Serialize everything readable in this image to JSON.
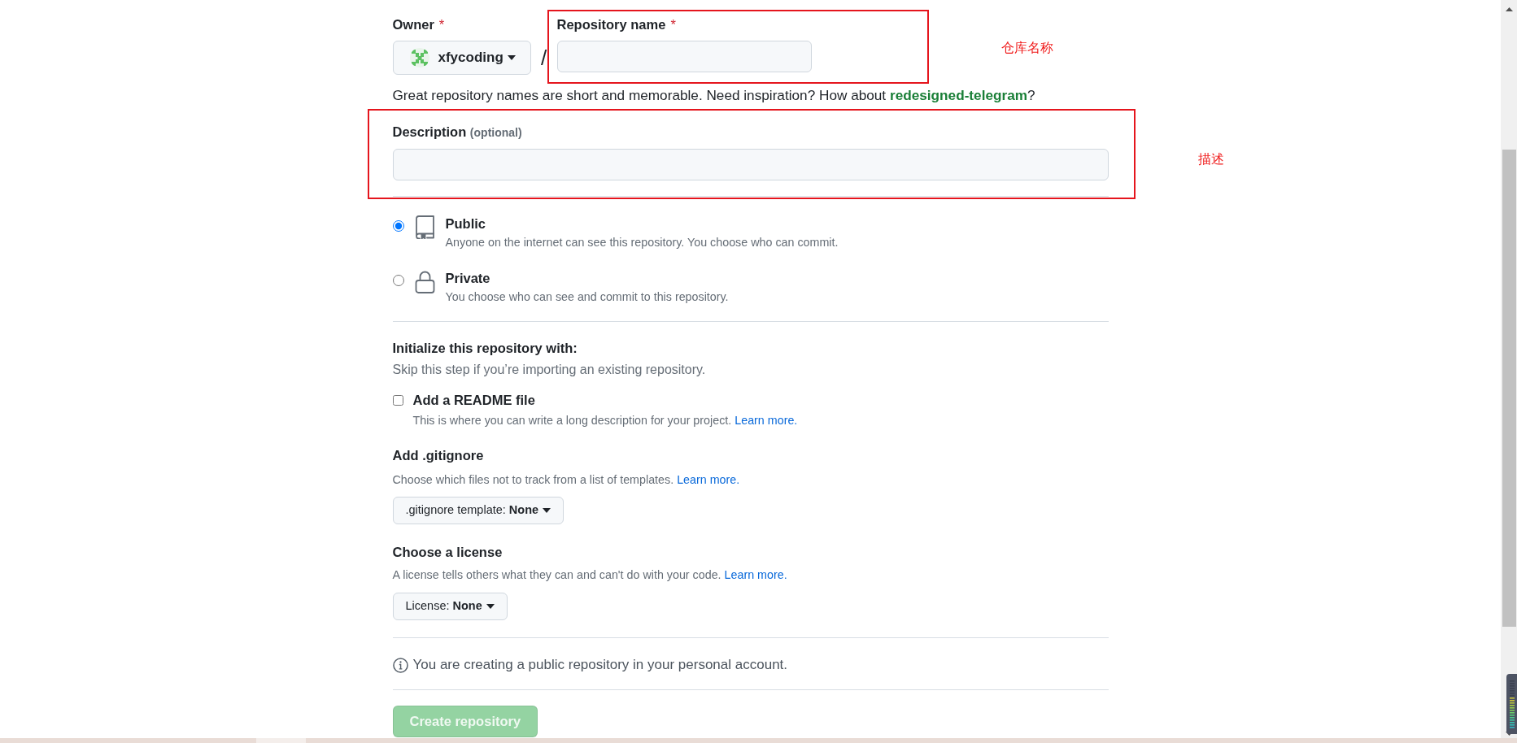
{
  "owner": {
    "label": "Owner",
    "required_mark": "*",
    "value": "xfycoding"
  },
  "separator": "/",
  "repository_name": {
    "label": "Repository name",
    "required_mark": "*",
    "annotation": "仓库名称"
  },
  "name_hint": {
    "text": "Great repository names are short and memorable. Need inspiration? How about",
    "suggestion": "redesigned-telegram",
    "tail": "?"
  },
  "description": {
    "label": "Description",
    "note": "(optional)",
    "annotation": "描述"
  },
  "visibility": [
    {
      "kind": "public",
      "label": "Public",
      "text": "Anyone on the internet can see this repository. You choose who can commit.",
      "selected": true
    },
    {
      "kind": "private",
      "label": "Private",
      "text": "You choose who can see and commit to this repository.",
      "selected": false
    }
  ],
  "initialize": {
    "title": "Initialize this repository with:",
    "subtitle": "Skip this step if you’re importing an existing repository.",
    "readme": {
      "label": "Add a README file",
      "checked": false,
      "text": "This is where you can write a long description for your project.",
      "link": "Learn more."
    }
  },
  "gitignore": {
    "title": "Add .gitignore",
    "text": "Choose which files not to track from a list of templates.",
    "link": "Learn more.",
    "dropdown": {
      "label": ".gitignore template:",
      "value": "None"
    }
  },
  "license": {
    "title": "Choose a license",
    "text": "A license tells others what they can and can't do with your code.",
    "link": "Learn more.",
    "dropdown": {
      "label": "License:",
      "value": "None"
    }
  },
  "notice": "You are creating a public repository in your personal account.",
  "submit": {
    "label": "Create repository",
    "disabled": true
  }
}
